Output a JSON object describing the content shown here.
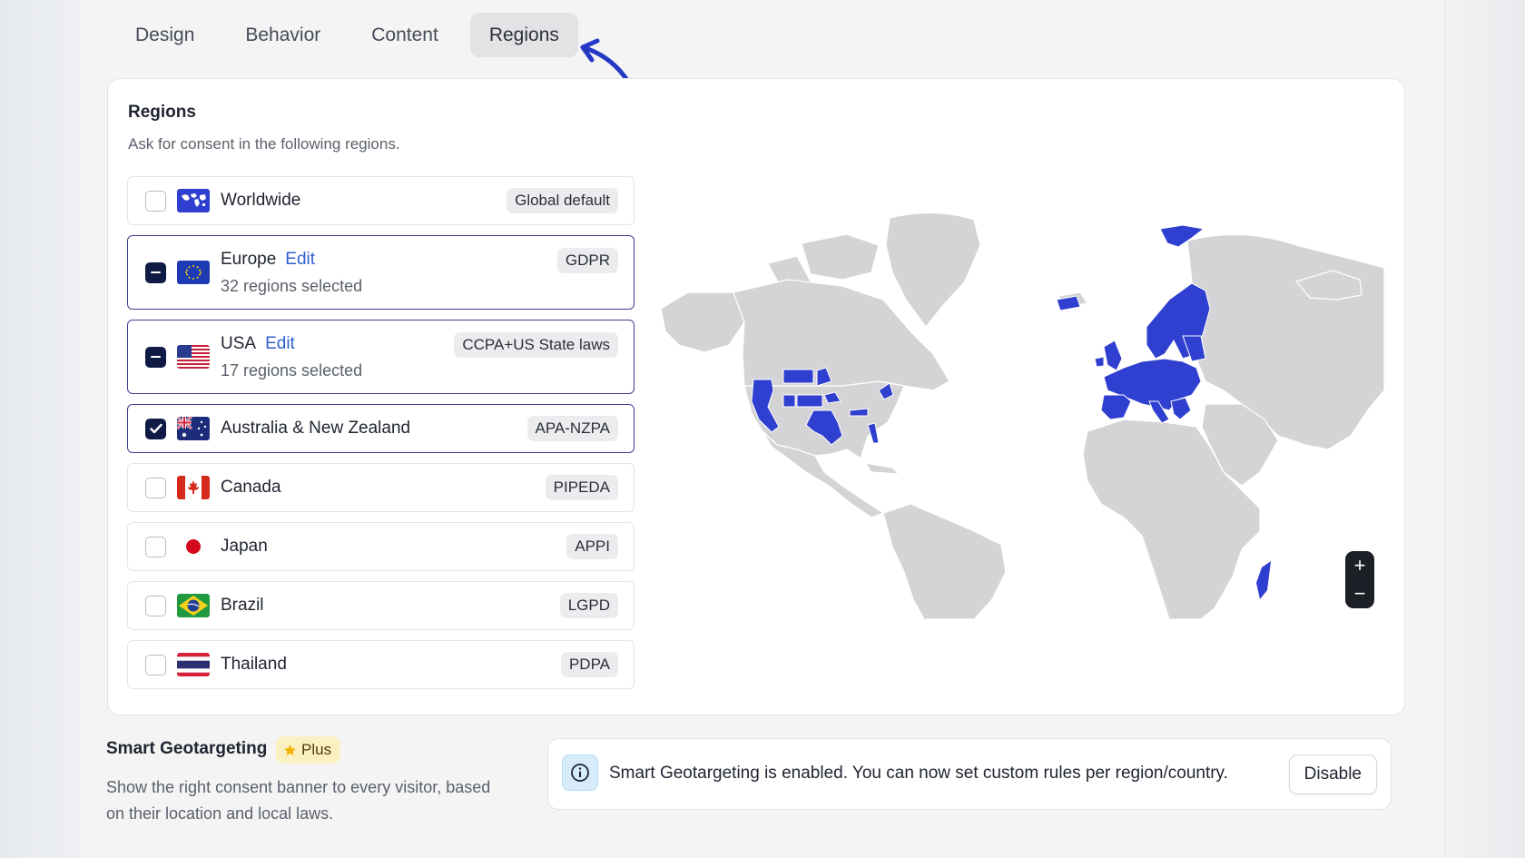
{
  "tabs": [
    {
      "label": "Design"
    },
    {
      "label": "Behavior"
    },
    {
      "label": "Content"
    },
    {
      "label": "Regions",
      "active": true
    }
  ],
  "regions_card": {
    "title": "Regions",
    "subtitle": "Ask for consent in the following regions.",
    "items": [
      {
        "name": "Worldwide",
        "badge": "Global default",
        "state": "unchecked",
        "flag": "world-flag"
      },
      {
        "name": "Europe",
        "edit": "Edit",
        "sub": "32 regions selected",
        "badge": "GDPR",
        "state": "partial",
        "flag": "eu-flag"
      },
      {
        "name": "USA",
        "edit": "Edit",
        "sub": "17 regions selected",
        "badge": "CCPA+US State laws",
        "state": "partial",
        "flag": "us-flag"
      },
      {
        "name": "Australia & New Zealand",
        "badge": "APA-NZPA",
        "state": "checked",
        "flag": "au-flag"
      },
      {
        "name": "Canada",
        "badge": "PIPEDA",
        "state": "unchecked",
        "flag": "ca-flag"
      },
      {
        "name": "Japan",
        "badge": "APPI",
        "state": "unchecked",
        "flag": "jp-flag"
      },
      {
        "name": "Brazil",
        "badge": "LGPD",
        "state": "unchecked",
        "flag": "br-flag"
      },
      {
        "name": "Thailand",
        "badge": "PDPA",
        "state": "unchecked",
        "flag": "th-flag"
      }
    ]
  },
  "map": {
    "selected_color": "#2f3fcf",
    "land_color": "#d4d4d6",
    "zoom_in": "+",
    "zoom_out": "−"
  },
  "geo": {
    "title": "Smart Geotargeting",
    "plus_label": "Plus",
    "description": "Show the right consent banner to every visitor, based on their location and local laws.",
    "info_text": "Smart Geotargeting is enabled. You can now set custom rules per region/country.",
    "disable_label": "Disable"
  },
  "colors": {
    "accent": "#2f3fcf",
    "checkbox_on": "#0f1b45",
    "link": "#2f5fcf"
  }
}
